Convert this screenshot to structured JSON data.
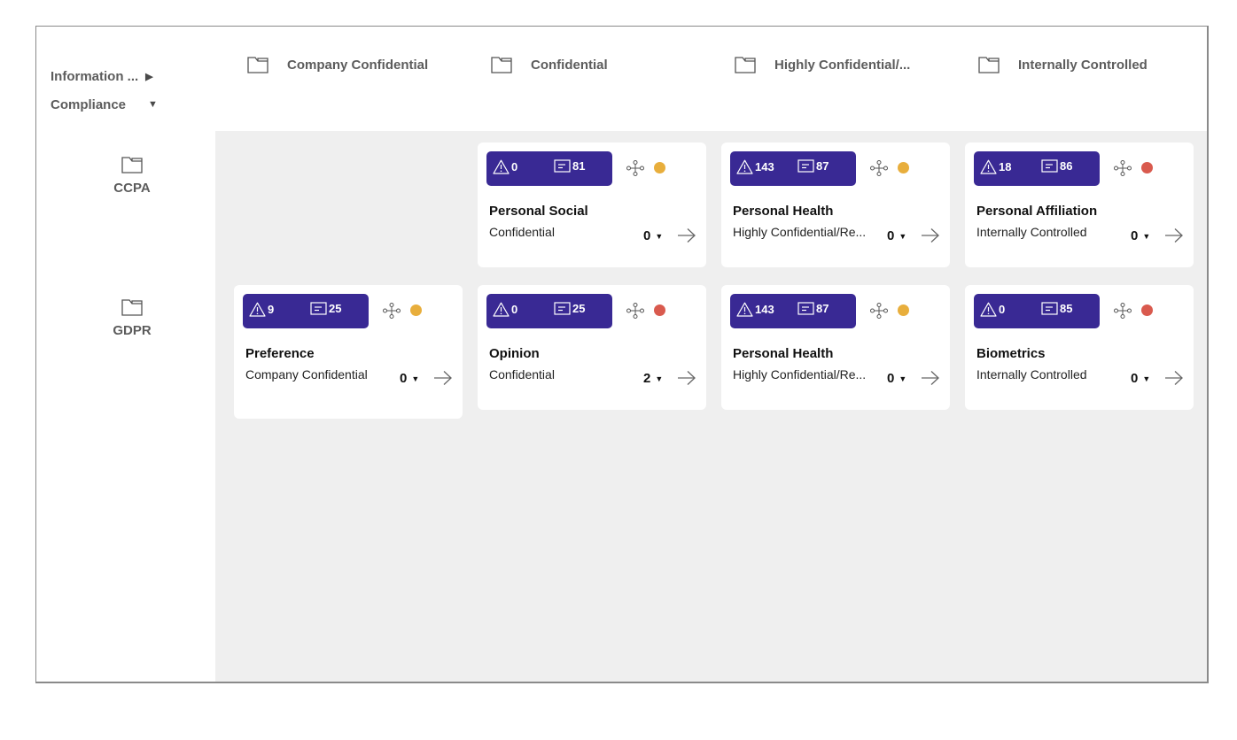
{
  "axes": {
    "rows_label": "Information ...",
    "rows_toggle_icon": "triangle-right-icon",
    "cols_label": "Compliance",
    "cols_toggle_icon": "triangle-down-icon"
  },
  "columns": [
    {
      "label": "Company Confidential",
      "icon": "folder-icon"
    },
    {
      "label": "Confidential",
      "icon": "folder-icon"
    },
    {
      "label": "Highly Confidential/...",
      "icon": "folder-icon"
    },
    {
      "label": "Internally Controlled",
      "icon": "folder-icon"
    }
  ],
  "rows": [
    {
      "label": "CCPA",
      "icon": "folder-icon"
    },
    {
      "label": "GDPR",
      "icon": "folder-icon"
    }
  ],
  "colors": {
    "badge": "#392994",
    "status_yellow": "#E8AE3C",
    "status_red": "#D95A4E",
    "grid_bg": "#EFEFEF"
  },
  "cards": {
    "ccpa_confidential": {
      "warnings": "0",
      "notes": "81",
      "status": "yellow",
      "status_color": "#E8AE3C",
      "title": "Personal Social",
      "classification": "Confidential",
      "count": "0"
    },
    "ccpa_highly": {
      "warnings": "143",
      "notes": "87",
      "status": "yellow",
      "status_color": "#E8AE3C",
      "title": "Personal Health",
      "classification": "Highly Confidential/Re...",
      "count": "0"
    },
    "ccpa_internal": {
      "warnings": "18",
      "notes": "86",
      "status": "red",
      "status_color": "#D95A4E",
      "title": "Personal Affiliation",
      "classification": "Internally Controlled",
      "count": "0"
    },
    "gdpr_company": {
      "warnings": "9",
      "notes": "25",
      "status": "yellow",
      "status_color": "#E8AE3C",
      "title": "Preference",
      "classification": "Company Confidential",
      "count": "0"
    },
    "gdpr_confidential": {
      "warnings": "0",
      "notes": "25",
      "status": "red",
      "status_color": "#D95A4E",
      "title": "Opinion",
      "classification": "Confidential",
      "count": "2"
    },
    "gdpr_highly": {
      "warnings": "143",
      "notes": "87",
      "status": "yellow",
      "status_color": "#E8AE3C",
      "title": "Personal Health",
      "classification": "Highly Confidential/Re...",
      "count": "0"
    },
    "gdpr_internal": {
      "warnings": "0",
      "notes": "85",
      "status": "red",
      "status_color": "#D95A4E",
      "title": "Biometrics",
      "classification": "Internally Controlled",
      "count": "0"
    }
  }
}
